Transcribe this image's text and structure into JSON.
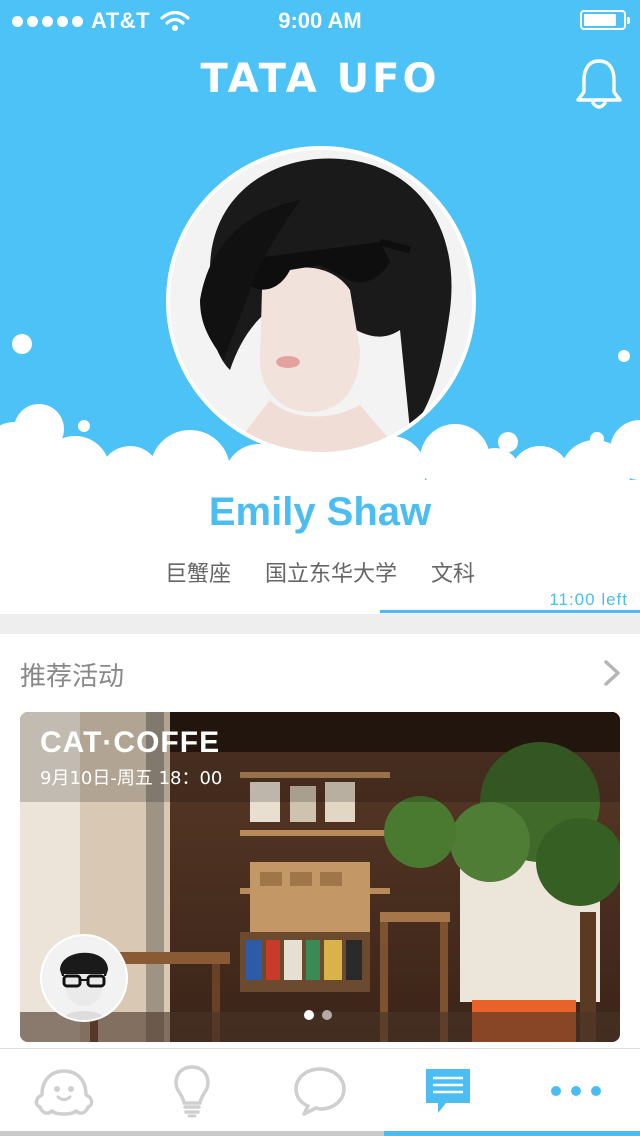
{
  "status_bar": {
    "carrier": "AT&T",
    "time": "9:00 AM"
  },
  "header": {
    "app_logo": "tata ufo"
  },
  "profile": {
    "name": "Emily Shaw",
    "tags": [
      "巨蟹座",
      "国立东华大学",
      "文科"
    ],
    "time_left": "11:00 left"
  },
  "section": {
    "title": "推荐活动"
  },
  "event": {
    "title": "CAT·COFFE",
    "time": "9月10日-周五 18：00",
    "pager_total": 2,
    "pager_active": 1
  },
  "tab_bar": {
    "items": [
      {
        "icon": "face-icon"
      },
      {
        "icon": "lightbulb-icon"
      },
      {
        "icon": "speech-bubble-icon"
      },
      {
        "icon": "message-list-icon",
        "active": true
      },
      {
        "icon": "more-dots-icon"
      }
    ],
    "accent": "#4cbdf0",
    "inactive": "#c9c9c9"
  },
  "colors": {
    "header_bg": "#4cc2f7",
    "accent": "#4cbdf0",
    "text_gray": "#666666"
  }
}
